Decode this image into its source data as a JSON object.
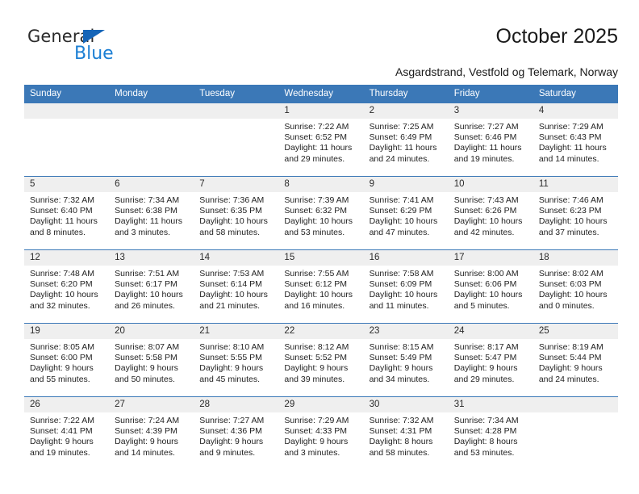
{
  "brand": {
    "name_top": "General",
    "name_bottom": "Blue",
    "triangle_icon": "triangle-icon",
    "color_dark": "#2b2b2b",
    "color_blue": "#1c7fd4"
  },
  "header": {
    "title": "October 2025",
    "subtitle": "Asgardstrand, Vestfold og Telemark, Norway"
  },
  "theme": {
    "header_blue": "#3b78b7",
    "daynum_gray": "#efefef",
    "text": "#222222"
  },
  "calendar": {
    "weekday_headers": [
      "Sunday",
      "Monday",
      "Tuesday",
      "Wednesday",
      "Thursday",
      "Friday",
      "Saturday"
    ],
    "weeks": [
      [
        {
          "day": "",
          "sunrise": "",
          "sunset": "",
          "daylight": ""
        },
        {
          "day": "",
          "sunrise": "",
          "sunset": "",
          "daylight": ""
        },
        {
          "day": "",
          "sunrise": "",
          "sunset": "",
          "daylight": ""
        },
        {
          "day": "1",
          "sunrise": "Sunrise: 7:22 AM",
          "sunset": "Sunset: 6:52 PM",
          "daylight": "Daylight: 11 hours and 29 minutes."
        },
        {
          "day": "2",
          "sunrise": "Sunrise: 7:25 AM",
          "sunset": "Sunset: 6:49 PM",
          "daylight": "Daylight: 11 hours and 24 minutes."
        },
        {
          "day": "3",
          "sunrise": "Sunrise: 7:27 AM",
          "sunset": "Sunset: 6:46 PM",
          "daylight": "Daylight: 11 hours and 19 minutes."
        },
        {
          "day": "4",
          "sunrise": "Sunrise: 7:29 AM",
          "sunset": "Sunset: 6:43 PM",
          "daylight": "Daylight: 11 hours and 14 minutes."
        }
      ],
      [
        {
          "day": "5",
          "sunrise": "Sunrise: 7:32 AM",
          "sunset": "Sunset: 6:40 PM",
          "daylight": "Daylight: 11 hours and 8 minutes."
        },
        {
          "day": "6",
          "sunrise": "Sunrise: 7:34 AM",
          "sunset": "Sunset: 6:38 PM",
          "daylight": "Daylight: 11 hours and 3 minutes."
        },
        {
          "day": "7",
          "sunrise": "Sunrise: 7:36 AM",
          "sunset": "Sunset: 6:35 PM",
          "daylight": "Daylight: 10 hours and 58 minutes."
        },
        {
          "day": "8",
          "sunrise": "Sunrise: 7:39 AM",
          "sunset": "Sunset: 6:32 PM",
          "daylight": "Daylight: 10 hours and 53 minutes."
        },
        {
          "day": "9",
          "sunrise": "Sunrise: 7:41 AM",
          "sunset": "Sunset: 6:29 PM",
          "daylight": "Daylight: 10 hours and 47 minutes."
        },
        {
          "day": "10",
          "sunrise": "Sunrise: 7:43 AM",
          "sunset": "Sunset: 6:26 PM",
          "daylight": "Daylight: 10 hours and 42 minutes."
        },
        {
          "day": "11",
          "sunrise": "Sunrise: 7:46 AM",
          "sunset": "Sunset: 6:23 PM",
          "daylight": "Daylight: 10 hours and 37 minutes."
        }
      ],
      [
        {
          "day": "12",
          "sunrise": "Sunrise: 7:48 AM",
          "sunset": "Sunset: 6:20 PM",
          "daylight": "Daylight: 10 hours and 32 minutes."
        },
        {
          "day": "13",
          "sunrise": "Sunrise: 7:51 AM",
          "sunset": "Sunset: 6:17 PM",
          "daylight": "Daylight: 10 hours and 26 minutes."
        },
        {
          "day": "14",
          "sunrise": "Sunrise: 7:53 AM",
          "sunset": "Sunset: 6:14 PM",
          "daylight": "Daylight: 10 hours and 21 minutes."
        },
        {
          "day": "15",
          "sunrise": "Sunrise: 7:55 AM",
          "sunset": "Sunset: 6:12 PM",
          "daylight": "Daylight: 10 hours and 16 minutes."
        },
        {
          "day": "16",
          "sunrise": "Sunrise: 7:58 AM",
          "sunset": "Sunset: 6:09 PM",
          "daylight": "Daylight: 10 hours and 11 minutes."
        },
        {
          "day": "17",
          "sunrise": "Sunrise: 8:00 AM",
          "sunset": "Sunset: 6:06 PM",
          "daylight": "Daylight: 10 hours and 5 minutes."
        },
        {
          "day": "18",
          "sunrise": "Sunrise: 8:02 AM",
          "sunset": "Sunset: 6:03 PM",
          "daylight": "Daylight: 10 hours and 0 minutes."
        }
      ],
      [
        {
          "day": "19",
          "sunrise": "Sunrise: 8:05 AM",
          "sunset": "Sunset: 6:00 PM",
          "daylight": "Daylight: 9 hours and 55 minutes."
        },
        {
          "day": "20",
          "sunrise": "Sunrise: 8:07 AM",
          "sunset": "Sunset: 5:58 PM",
          "daylight": "Daylight: 9 hours and 50 minutes."
        },
        {
          "day": "21",
          "sunrise": "Sunrise: 8:10 AM",
          "sunset": "Sunset: 5:55 PM",
          "daylight": "Daylight: 9 hours and 45 minutes."
        },
        {
          "day": "22",
          "sunrise": "Sunrise: 8:12 AM",
          "sunset": "Sunset: 5:52 PM",
          "daylight": "Daylight: 9 hours and 39 minutes."
        },
        {
          "day": "23",
          "sunrise": "Sunrise: 8:15 AM",
          "sunset": "Sunset: 5:49 PM",
          "daylight": "Daylight: 9 hours and 34 minutes."
        },
        {
          "day": "24",
          "sunrise": "Sunrise: 8:17 AM",
          "sunset": "Sunset: 5:47 PM",
          "daylight": "Daylight: 9 hours and 29 minutes."
        },
        {
          "day": "25",
          "sunrise": "Sunrise: 8:19 AM",
          "sunset": "Sunset: 5:44 PM",
          "daylight": "Daylight: 9 hours and 24 minutes."
        }
      ],
      [
        {
          "day": "26",
          "sunrise": "Sunrise: 7:22 AM",
          "sunset": "Sunset: 4:41 PM",
          "daylight": "Daylight: 9 hours and 19 minutes."
        },
        {
          "day": "27",
          "sunrise": "Sunrise: 7:24 AM",
          "sunset": "Sunset: 4:39 PM",
          "daylight": "Daylight: 9 hours and 14 minutes."
        },
        {
          "day": "28",
          "sunrise": "Sunrise: 7:27 AM",
          "sunset": "Sunset: 4:36 PM",
          "daylight": "Daylight: 9 hours and 9 minutes."
        },
        {
          "day": "29",
          "sunrise": "Sunrise: 7:29 AM",
          "sunset": "Sunset: 4:33 PM",
          "daylight": "Daylight: 9 hours and 3 minutes."
        },
        {
          "day": "30",
          "sunrise": "Sunrise: 7:32 AM",
          "sunset": "Sunset: 4:31 PM",
          "daylight": "Daylight: 8 hours and 58 minutes."
        },
        {
          "day": "31",
          "sunrise": "Sunrise: 7:34 AM",
          "sunset": "Sunset: 4:28 PM",
          "daylight": "Daylight: 8 hours and 53 minutes."
        },
        {
          "day": "",
          "sunrise": "",
          "sunset": "",
          "daylight": ""
        }
      ]
    ]
  }
}
